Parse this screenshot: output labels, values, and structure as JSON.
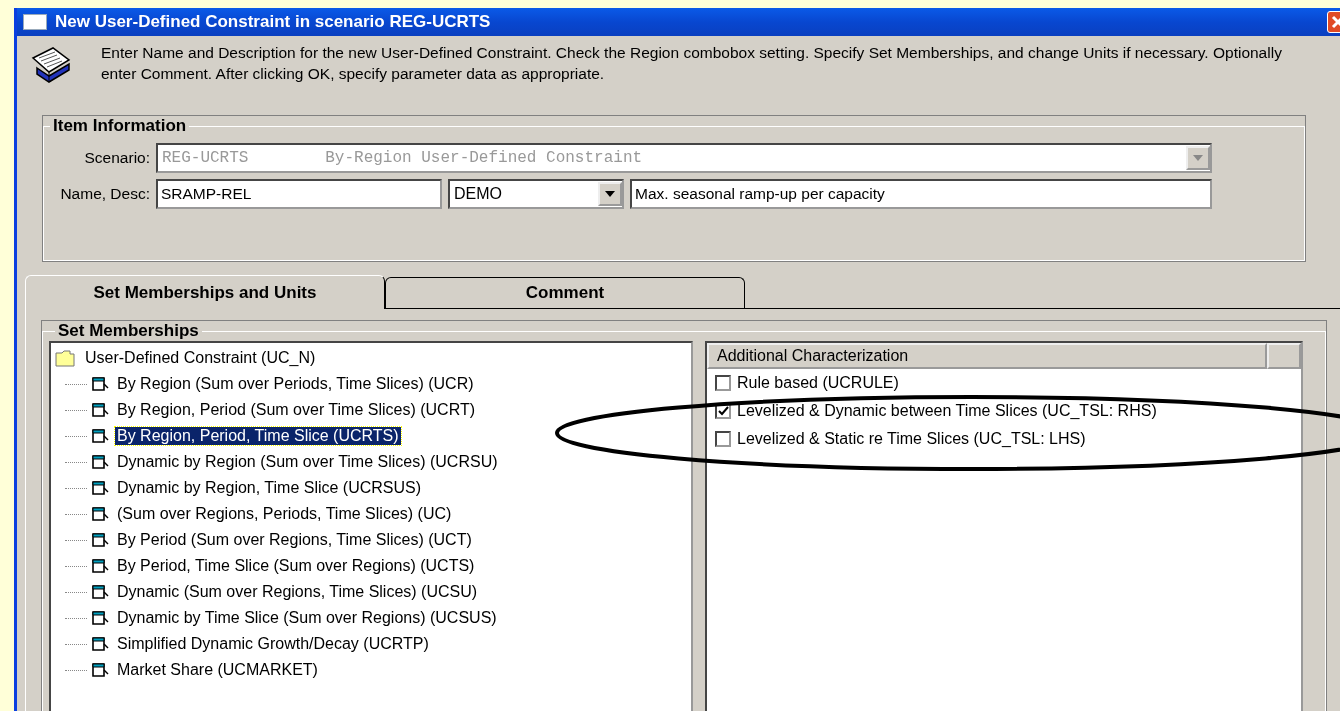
{
  "window": {
    "title": "New User-Defined Constraint in scenario REG-UCRTS"
  },
  "instructions": "Enter Name and Description for the new User-Defined Constraint. Check the Region combobox setting. Specify Set Memberships, and change Units if necessary.  Optionally enter Comment. After clicking OK, specify parameter data as appropriate.",
  "item_information": {
    "title": "Item Information",
    "scenario_label": "Scenario:",
    "scenario_value": "REG-UCRTS        By-Region User-Defined Constraint",
    "scenario_disabled": true,
    "name_label": "Name, Desc:",
    "name_value": "SRAMP-REL",
    "region_value": "DEMO",
    "description_value": "Max. seasonal ramp-up per capacity"
  },
  "tabs": [
    {
      "label": "Set Memberships and Units",
      "selected": true
    },
    {
      "label": "Comment",
      "selected": false
    }
  ],
  "set_memberships": {
    "title": "Set Memberships",
    "tree": {
      "label": "User-Defined Constraint (UC_N)",
      "expanded": true,
      "children": [
        {
          "label": "By Region (Sum over Periods, Time Slices) (UCR)",
          "selected": false
        },
        {
          "label": "By Region, Period (Sum over Time Slices) (UCRT)",
          "selected": false
        },
        {
          "label": "By Region, Period, Time Slice (UCRTS)",
          "selected": true
        },
        {
          "label": "Dynamic by Region (Sum over Time Slices) (UCRSU)",
          "selected": false
        },
        {
          "label": "Dynamic by Region, Time Slice (UCRSUS)",
          "selected": false
        },
        {
          "label": "(Sum over Regions, Periods, Time Slices) (UC)",
          "selected": false
        },
        {
          "label": "By Period (Sum over Regions, Time Slices) (UCT)",
          "selected": false
        },
        {
          "label": "By Period, Time Slice (Sum over Regions) (UCTS)",
          "selected": false
        },
        {
          "label": "Dynamic (Sum over Regions, Time Slices) (UCSU)",
          "selected": false
        },
        {
          "label": "Dynamic by Time Slice (Sum over Regions) (UCSUS)",
          "selected": false
        },
        {
          "label": "Simplified Dynamic Growth/Decay (UCRTP)",
          "selected": false
        },
        {
          "label": "Market Share (UCMARKET)",
          "selected": false
        }
      ]
    },
    "characterization": {
      "header": "Additional Characterization",
      "items": [
        {
          "label": "Rule based (UCRULE)",
          "checked": false
        },
        {
          "label": "Levelized & Dynamic between Time Slices (UC_TSL: RHS)",
          "checked": true
        },
        {
          "label": "Levelized & Static re Time Slices (UC_TSL: LHS)",
          "checked": false
        }
      ]
    }
  },
  "annotation": {
    "kind": "ellipse"
  }
}
